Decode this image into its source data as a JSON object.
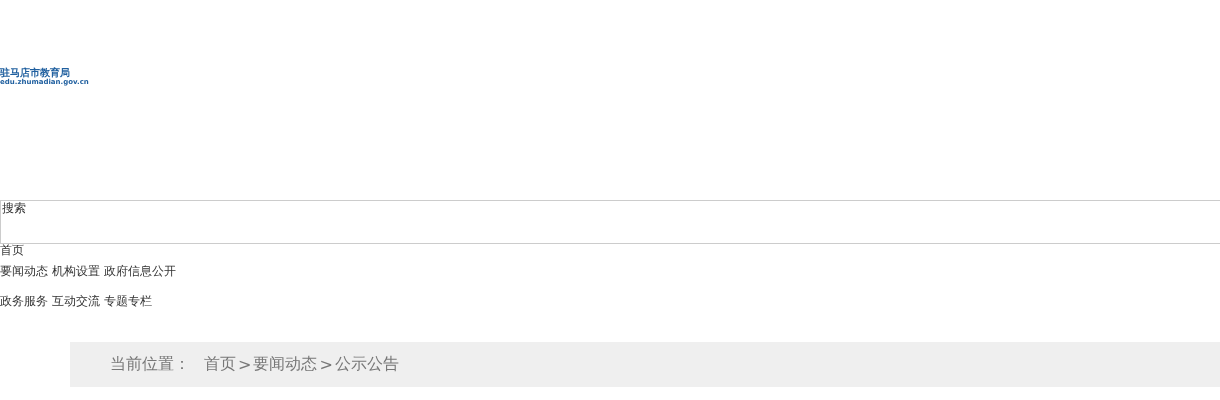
{
  "logo": {
    "name": "驻马店市教育局",
    "domain": "edu.zhumadian.gov.cn"
  },
  "search": {
    "placeholder": "搜索"
  },
  "nav": {
    "home": "首页",
    "rows": [
      [
        "要闻动态",
        "机构设置",
        "政府信息公开"
      ],
      [
        "政务服务",
        "互动交流",
        "专题专栏"
      ]
    ]
  },
  "breadcrumb": {
    "label": "当前位置：",
    "separator": ">",
    "items": [
      "首页",
      "要闻动态",
      "公示公告"
    ]
  }
}
